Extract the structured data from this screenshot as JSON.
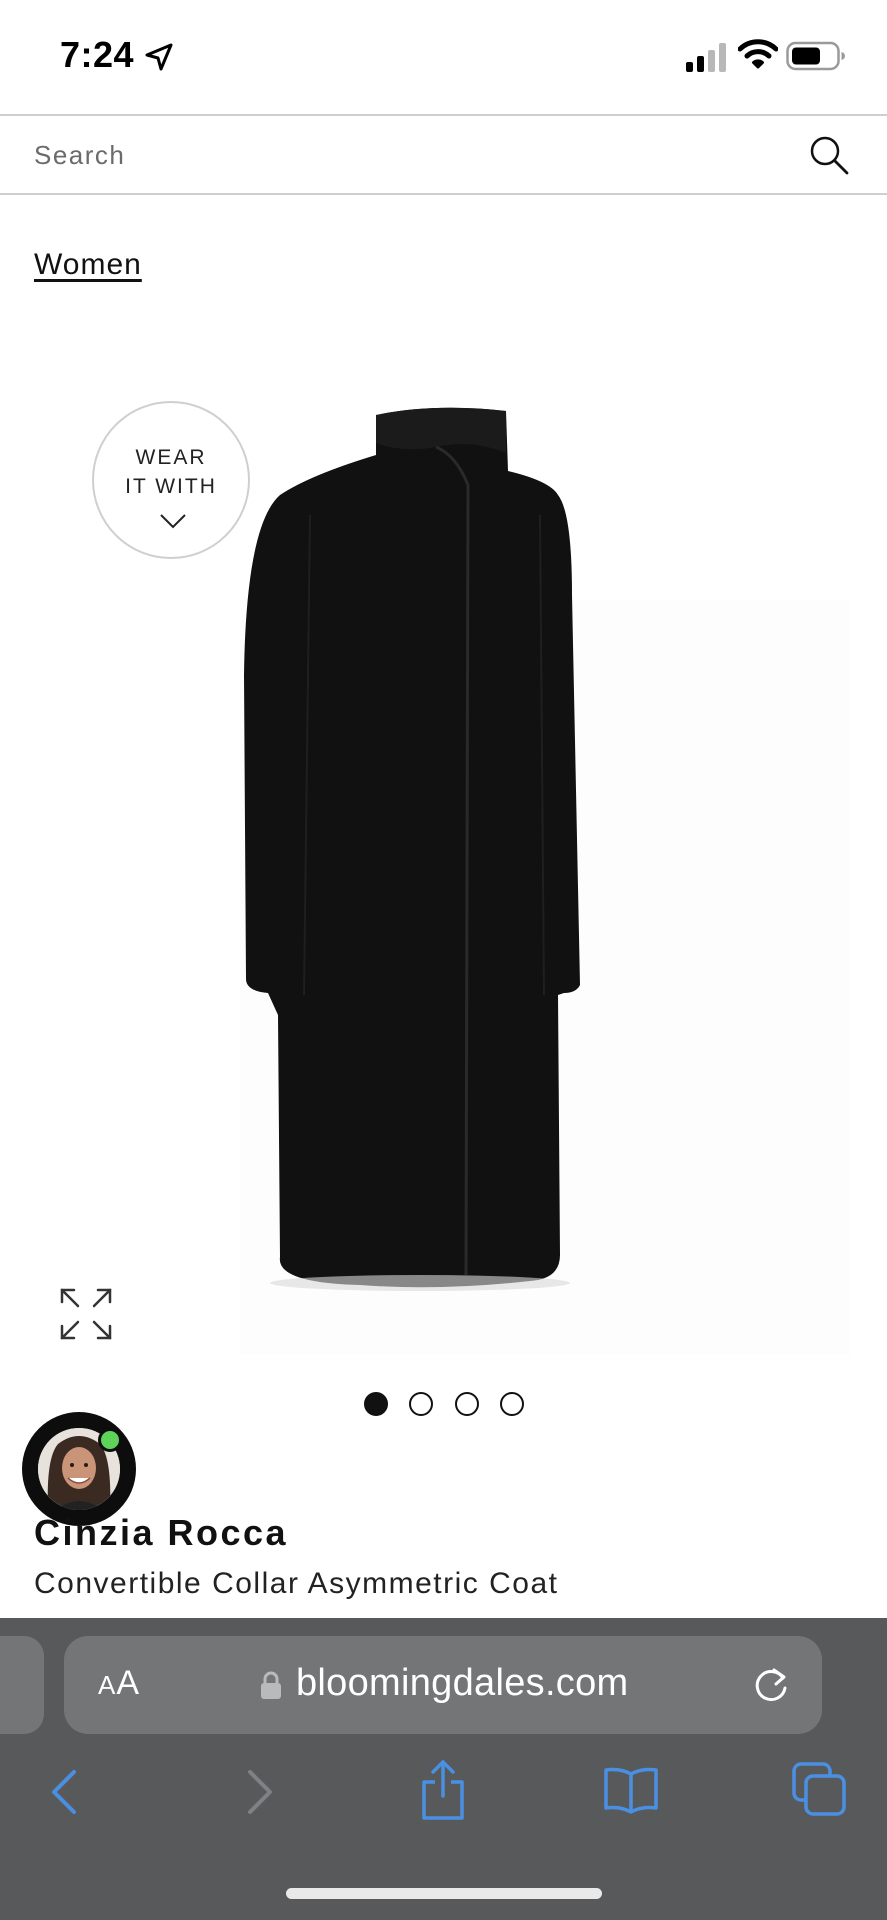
{
  "status_bar": {
    "time": "7:24",
    "icons": [
      "location-arrow-icon",
      "cellular-signal-icon",
      "wifi-icon",
      "battery-icon"
    ]
  },
  "search": {
    "placeholder": "Search",
    "value": ""
  },
  "breadcrumb": {
    "label": "Women"
  },
  "product_media": {
    "wear_it_with_line1": "WEAR",
    "wear_it_with_line2": "IT WITH",
    "image_count": 4,
    "active_image": 1,
    "image_subject": "black long coat"
  },
  "product": {
    "brand": "Cinzia Rocca",
    "name": "Convertible Collar Asymmetric Coat"
  },
  "browser": {
    "aa_small": "A",
    "aa_large": "A",
    "url": "bloomingdales.com",
    "toolbar_icons": [
      "back-icon",
      "forward-icon",
      "share-icon",
      "bookmarks-icon",
      "tabs-icon"
    ]
  },
  "colors": {
    "toolbar_bg": "#58595b",
    "address_bar_bg": "#747577",
    "toolbar_accent": "#4a90e2",
    "online_indicator": "#5ed35a"
  }
}
